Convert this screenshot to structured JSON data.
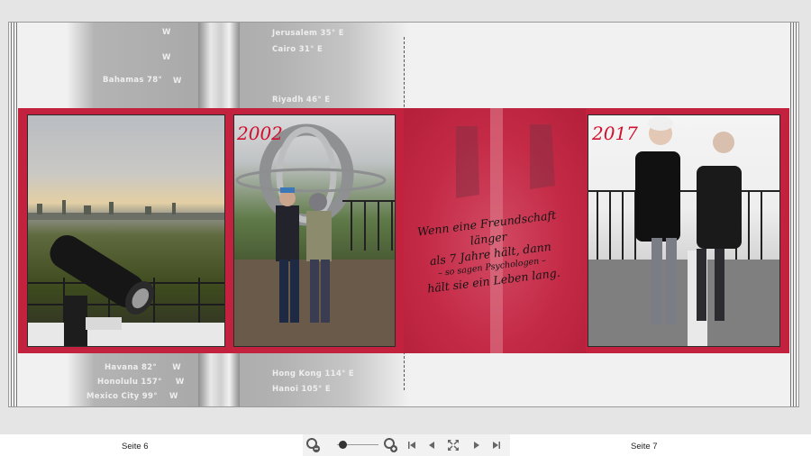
{
  "book": {
    "left_page": {
      "label": "Seite 6"
    },
    "right_page": {
      "label": "Seite 7"
    }
  },
  "background_signpost": {
    "top_left": [
      "Bahamas 78°",
      "W"
    ],
    "top_right": [
      [
        "Jerusalem 35°",
        "E"
      ],
      [
        "Cairo 31°",
        "E"
      ],
      [
        "Riyadh 46°",
        "E"
      ]
    ],
    "bottom_left": [
      [
        "Havana 82°",
        "W"
      ],
      [
        "Honolulu 157°",
        "W"
      ],
      [
        "Mexico City 99°",
        "W"
      ]
    ],
    "bottom_right": [
      [
        "Hong Kong 114°",
        "E"
      ],
      [
        "Hanoi 105°",
        "E"
      ]
    ],
    "top_w_marks": [
      "W",
      "W",
      "W"
    ]
  },
  "photos": {
    "year_2002": "2002",
    "year_2017": "2017"
  },
  "quote": {
    "line1": "Wenn eine Freundschaft länger",
    "line2": "als 7 Jahre hält, dann",
    "line3": "– so sagen Psychologen –",
    "line4": "hält sie ein Leben lang."
  },
  "toolbar": {
    "zoom_level": 0.15
  },
  "colors": {
    "accent_red": "#c3223f",
    "year_red": "#d0102e"
  }
}
